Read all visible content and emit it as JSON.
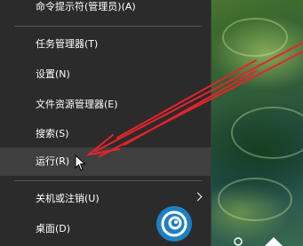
{
  "context_menu": {
    "items": [
      {
        "label": "命令提示符(管理员)(A)"
      },
      {
        "label": "任务管理器(T)"
      },
      {
        "label": "设置(N)"
      },
      {
        "label": "文件资源管理器(E)"
      },
      {
        "label": "搜索(S)"
      },
      {
        "label": "运行(R)"
      },
      {
        "label": "关机或注销(U)"
      },
      {
        "label": "桌面(D)"
      }
    ]
  },
  "icons": {
    "submenu": "chevron-right-icon",
    "cursor": "mouse-pointer-icon",
    "annotation": "red-arrow-icon",
    "watermark": "watermark-logo-icon"
  },
  "colors": {
    "menu_bg": "#2b2b2b",
    "menu_hover": "#3f3f3f",
    "annotation_red": "#e8232a"
  }
}
